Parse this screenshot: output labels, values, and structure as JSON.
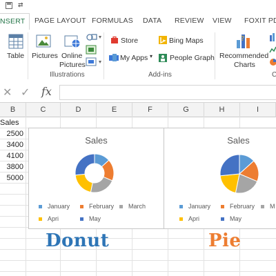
{
  "tabs": [
    {
      "label": "NSERT",
      "active": true
    },
    {
      "label": "PAGE LAYOUT"
    },
    {
      "label": "FORMULAS"
    },
    {
      "label": "DATA"
    },
    {
      "label": "REVIEW"
    },
    {
      "label": "VIEW"
    },
    {
      "label": "FOXIT PDF"
    }
  ],
  "ribbon": {
    "table": "Table",
    "pictures": "Pictures",
    "online_pictures_1": "Online",
    "online_pictures_2": "Pictures",
    "illustrations_group": "Illustrations",
    "store": "Store",
    "my_apps": "My Apps",
    "bing_maps": "Bing Maps",
    "people_graph": "People Graph",
    "addins_group": "Add-ins",
    "recommended_1": "Recommended",
    "recommended_2": "Charts",
    "charts_group_partial": "C"
  },
  "formula_bar": {
    "cancel": "✕",
    "enter": "✓",
    "fx": "fx",
    "value": ""
  },
  "columns": [
    "B",
    "C",
    "D",
    "E",
    "F",
    "G",
    "H",
    "I"
  ],
  "sheet": {
    "header": "Sales",
    "values": [
      "2500",
      "3400",
      "4100",
      "3800",
      "5000"
    ]
  },
  "chart_data": [
    {
      "type": "pie",
      "variant": "donut",
      "title": "Sales",
      "categories": [
        "January",
        "February",
        "March",
        "April",
        "May"
      ],
      "values": [
        2500,
        3400,
        4100,
        3800,
        5000
      ],
      "legend_placement": "bottom"
    },
    {
      "type": "pie",
      "title": "Sales",
      "categories": [
        "January",
        "February",
        "March",
        "April",
        "May"
      ],
      "values": [
        2500,
        3400,
        4100,
        3800,
        5000
      ],
      "legend_placement": "bottom"
    }
  ],
  "legend": {
    "donut": [
      "January",
      "February",
      "March",
      "Apri",
      "May"
    ],
    "pie": [
      "January",
      "February",
      "M",
      "Apri",
      "May"
    ]
  },
  "colors": {
    "series": [
      "#5b9bd5",
      "#ed7d31",
      "#a5a5a5",
      "#ffc000",
      "#4472c4"
    ],
    "excel_green": "#217346",
    "donut_label": "#2e75b6",
    "pie_label": "#ed7d31"
  },
  "captions": {
    "donut": "Donut",
    "pie": "Pie"
  }
}
